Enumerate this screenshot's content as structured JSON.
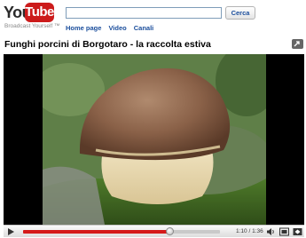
{
  "header": {
    "logo_you": "You",
    "logo_tube": "Tube",
    "tagline": "Broadcast Yourself ™",
    "search": {
      "value": "",
      "placeholder": ""
    },
    "search_button": "Cerca",
    "nav": [
      {
        "label": "Home page"
      },
      {
        "label": "Video"
      },
      {
        "label": "Canali"
      }
    ]
  },
  "video": {
    "title": "Funghi porcini di Borgotaro - la raccolta estiva",
    "progress": 0.743,
    "time": "1:10 / 1:36"
  },
  "colors": {
    "brand_red": "#cc1b1b",
    "link_blue": "#1b4e9c",
    "progress_red": "#d51a1a"
  },
  "icons": {
    "play": "play-icon",
    "share": "share-icon",
    "volume": "volume-icon",
    "size": "size-toggle-icon",
    "fullscreen": "fullscreen-icon"
  }
}
